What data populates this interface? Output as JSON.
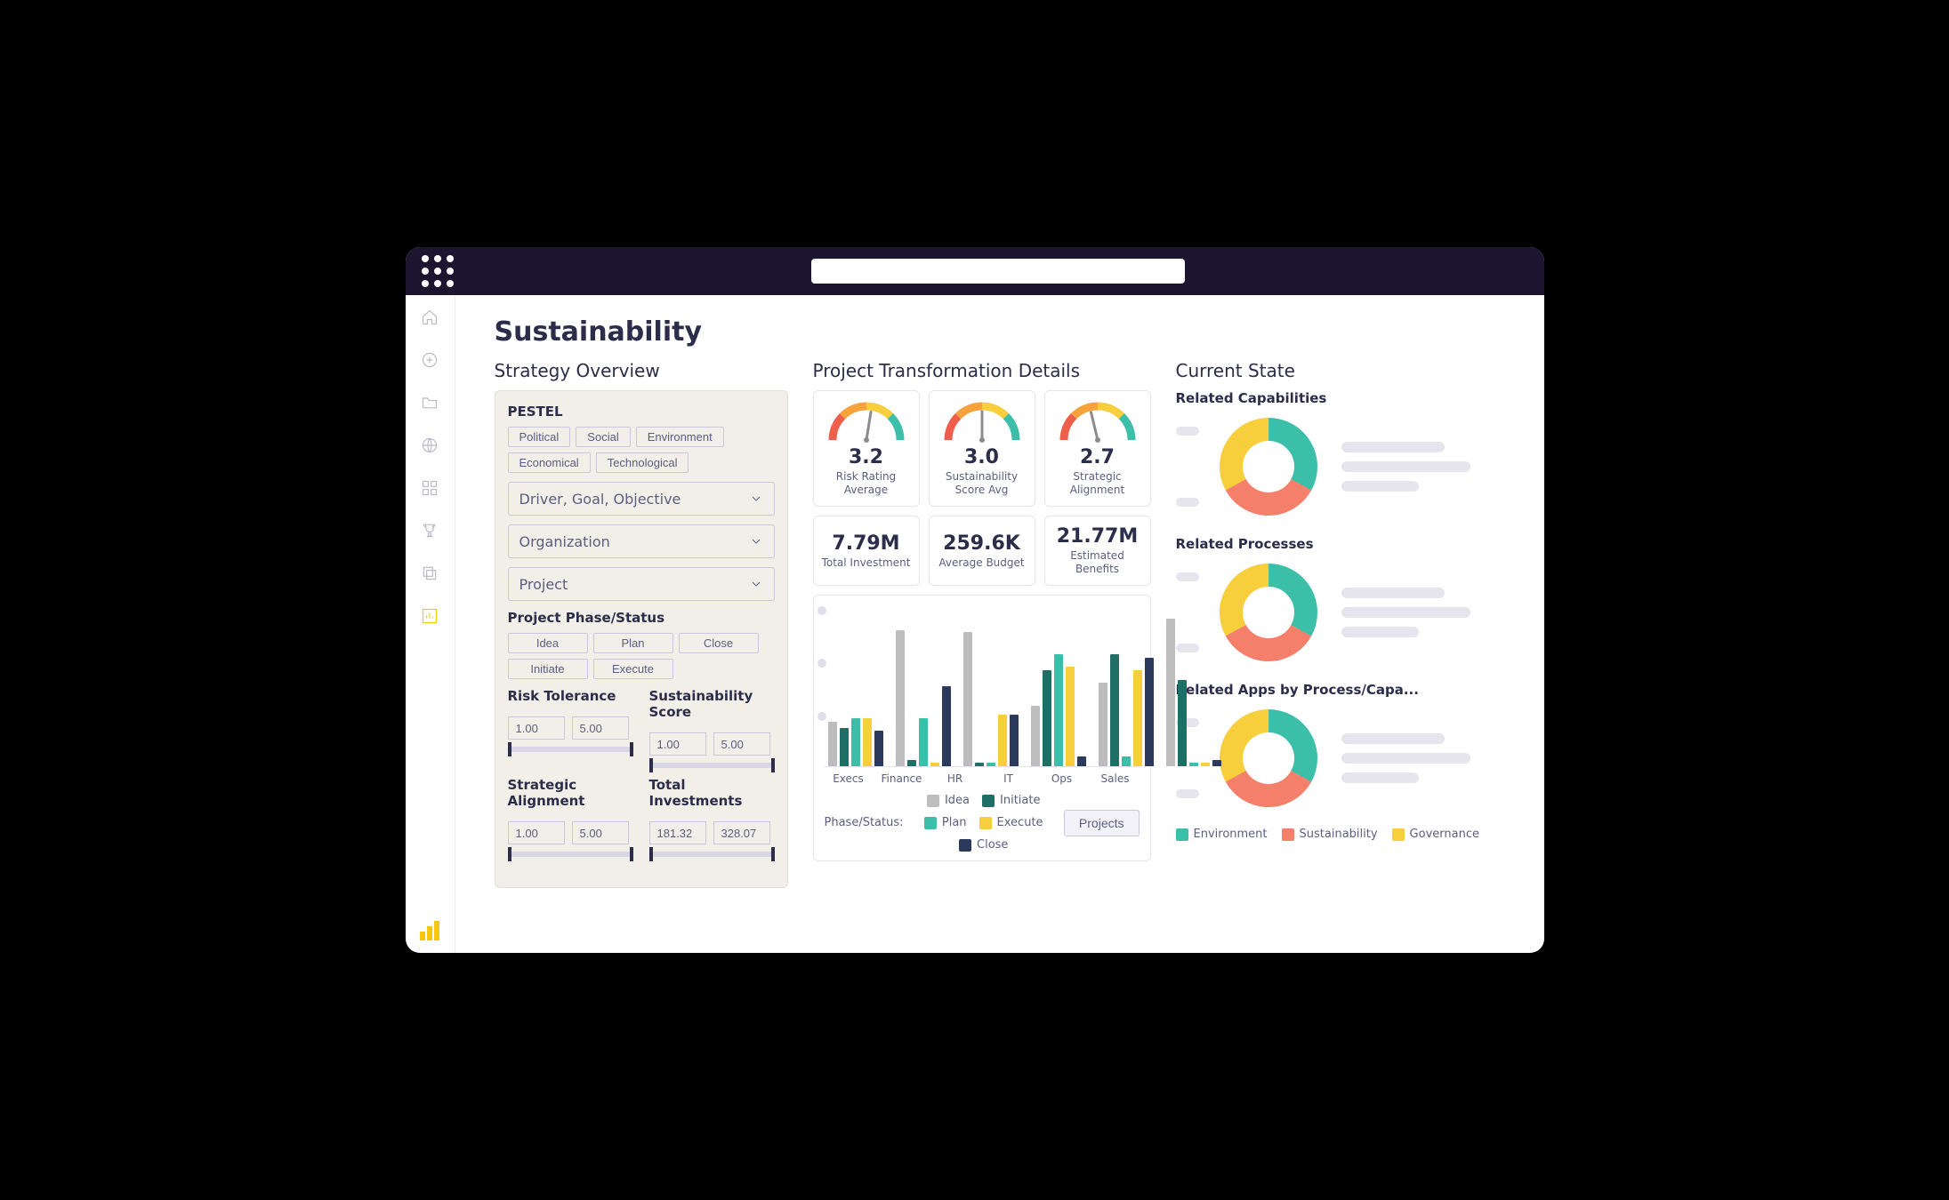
{
  "page_title": "Sustainability",
  "rail": {
    "items": [
      "home",
      "add",
      "folder",
      "globe",
      "apps",
      "trophy",
      "layers",
      "chart"
    ]
  },
  "strategy": {
    "heading": "Strategy Overview",
    "pestel_label": "PESTEL",
    "pestel": [
      "Political",
      "Social",
      "Environment",
      "Economical",
      "Technological"
    ],
    "selects": {
      "driver": "Driver, Goal, Objective",
      "organization": "Organization",
      "project": "Project"
    },
    "phase_label": "Project Phase/Status",
    "phases": [
      "Idea",
      "Plan",
      "Close",
      "Initiate",
      "Execute"
    ],
    "ranges": {
      "risk": {
        "label": "Risk Tolerance",
        "min": "1.00",
        "max": "5.00"
      },
      "sust": {
        "label": "Sustainability Score",
        "min": "1.00",
        "max": "5.00"
      },
      "strat": {
        "label": "Strategic Alignment",
        "min": "1.00",
        "max": "5.00"
      },
      "invest": {
        "label": "Total Investments",
        "min": "181.32",
        "max": "328.07"
      }
    }
  },
  "transformation": {
    "heading": "Project Transformation Details",
    "gauges": [
      {
        "value": "3.2",
        "label": "Risk Rating Average"
      },
      {
        "value": "3.0",
        "label": "Sustainability Score Avg"
      },
      {
        "value": "2.7",
        "label": "Strategic Alignment"
      }
    ],
    "stats": [
      {
        "value": "7.79M",
        "label": "Total Investment"
      },
      {
        "value": "259.6K",
        "label": "Average Budget"
      },
      {
        "value": "21.77M",
        "label": "Estimated Benefits"
      }
    ],
    "legend_title": "Phase/Status:",
    "legend": [
      {
        "name": "Idea",
        "color": "#bdbdbd"
      },
      {
        "name": "Initiate",
        "color": "#1f6f66"
      },
      {
        "name": "Plan",
        "color": "#3bbfa8"
      },
      {
        "name": "Execute",
        "color": "#f7cf3d"
      },
      {
        "name": "Close",
        "color": "#2b3a5c"
      }
    ],
    "projects_btn": "Projects"
  },
  "chart_data": {
    "type": "bar",
    "title": "",
    "xlabel": "",
    "ylabel": "",
    "ylim": [
      0,
      100
    ],
    "categories": [
      "Execs",
      "Finance",
      "HR",
      "IT",
      "Ops",
      "Sales"
    ],
    "series": [
      {
        "name": "Idea",
        "color": "#bdbdbd",
        "values": [
          28,
          85,
          84,
          38,
          52,
          92
        ]
      },
      {
        "name": "Initiate",
        "color": "#1f6f66",
        "values": [
          24,
          4,
          2,
          60,
          70,
          54
        ]
      },
      {
        "name": "Plan",
        "color": "#3bbfa8",
        "values": [
          30,
          30,
          2,
          70,
          6,
          2
        ]
      },
      {
        "name": "Execute",
        "color": "#f7cf3d",
        "values": [
          30,
          2,
          32,
          62,
          60,
          2
        ]
      },
      {
        "name": "Close",
        "color": "#2b3a5c",
        "values": [
          22,
          50,
          32,
          6,
          68,
          4
        ]
      }
    ]
  },
  "current": {
    "heading": "Current State",
    "blocks": [
      {
        "title": "Related Capabilities"
      },
      {
        "title": "Related Processes"
      },
      {
        "title": "Related Apps by Process/Capa..."
      }
    ],
    "donut_slices": [
      {
        "name": "Environment",
        "color": "#3bbfa8",
        "value": 33
      },
      {
        "name": "Sustainability",
        "color": "#f4806b",
        "value": 34
      },
      {
        "name": "Governance",
        "color": "#f7cf3d",
        "value": 33
      }
    ],
    "legend": [
      {
        "name": "Environment",
        "color": "#3bbfa8"
      },
      {
        "name": "Sustainability",
        "color": "#f4806b"
      },
      {
        "name": "Governance",
        "color": "#f7cf3d"
      }
    ]
  }
}
